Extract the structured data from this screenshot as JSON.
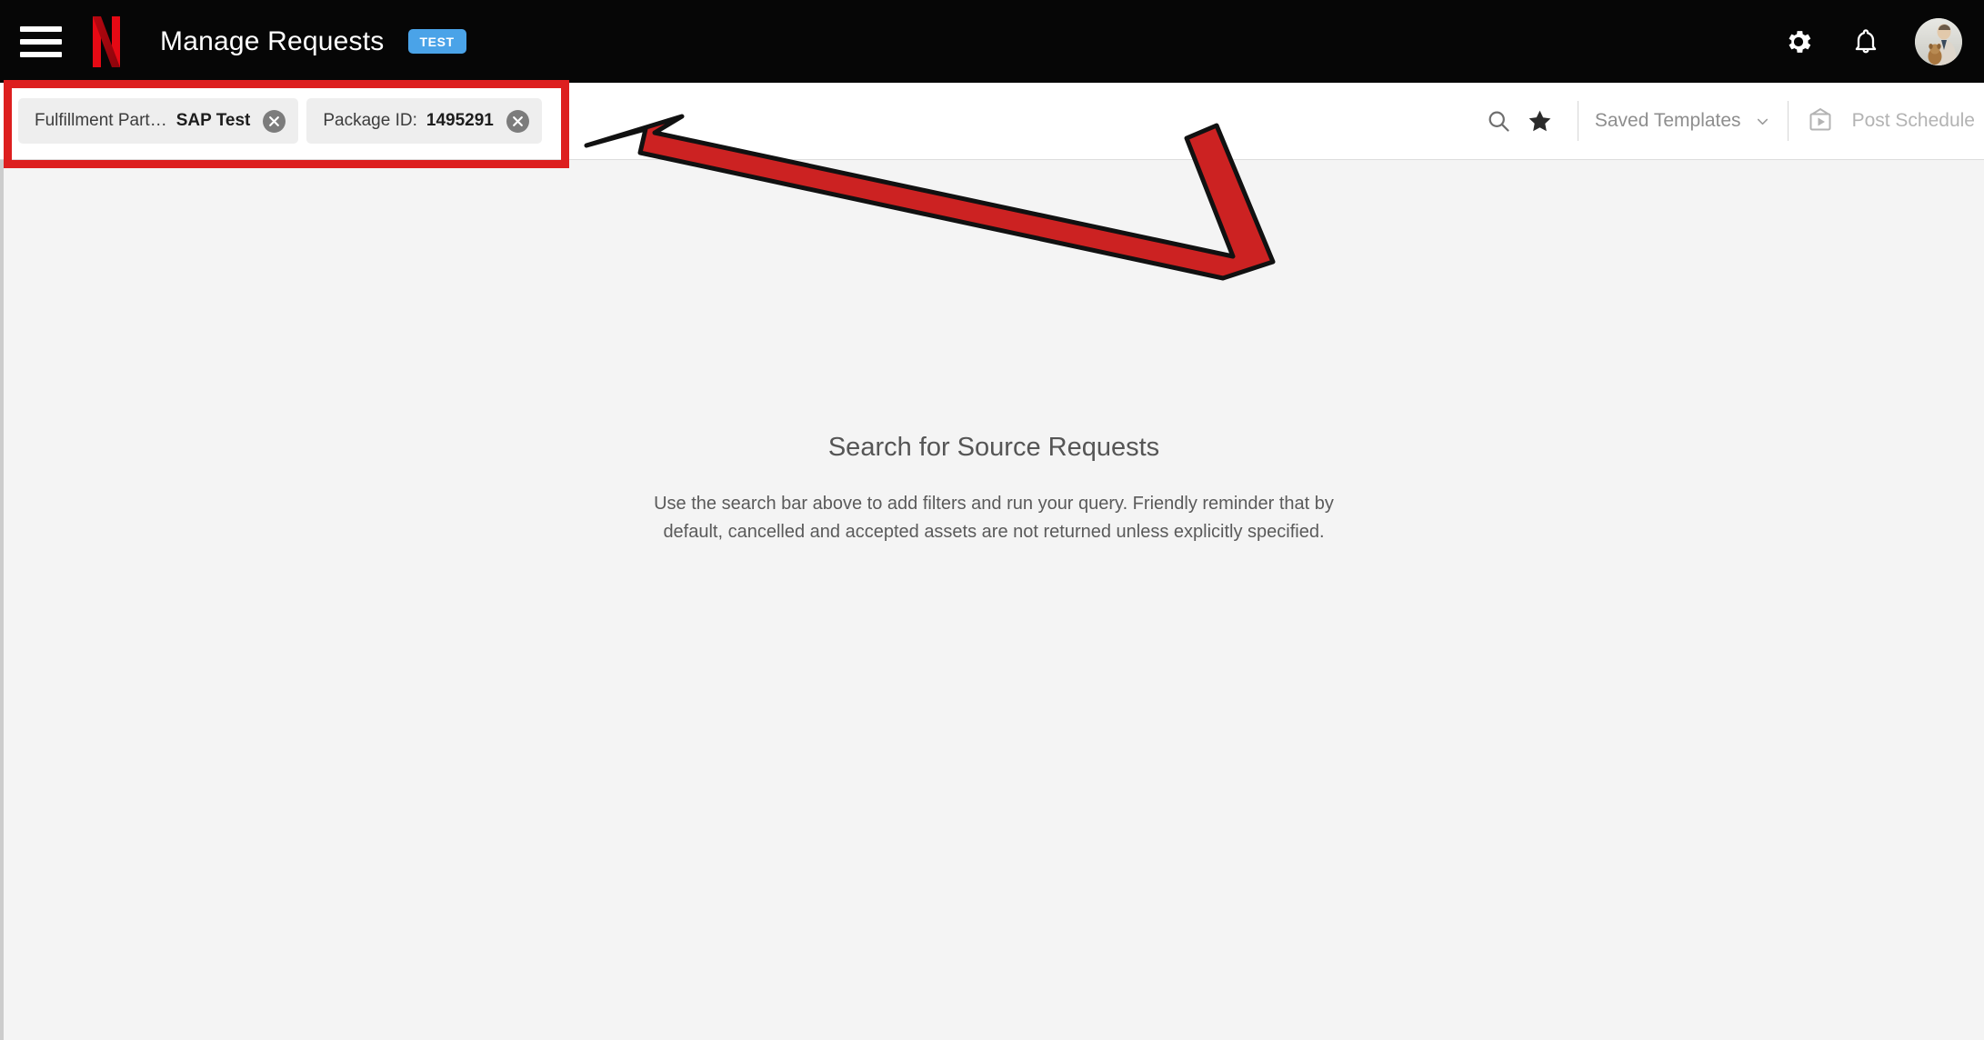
{
  "header": {
    "menu_icon": "hamburger-menu-icon",
    "brand_logo": "netflix-n-logo",
    "title": "Manage Requests",
    "env_badge": "TEST",
    "settings_icon": "gear-icon",
    "notifications_icon": "bell-icon",
    "avatar": "user-avatar"
  },
  "toolbar": {
    "filter_chips": [
      {
        "key": "Fulfillment Part…",
        "value": "SAP Test",
        "remove_icon": "close-circle-icon"
      },
      {
        "key": "Package ID:",
        "value": "1495291",
        "remove_icon": "close-circle-icon"
      }
    ],
    "search_icon": "search-icon",
    "favorite_icon": "star-filled-icon",
    "saved_templates_label": "Saved Templates",
    "saved_templates_chevron": "chevron-down-icon",
    "post_schedule_icon": "tv-play-icon",
    "post_schedule_label": "Post Schedule"
  },
  "main": {
    "empty_title": "Search for Source Requests",
    "empty_subtitle": "Use the search bar above to add filters and run your query. Friendly reminder that by default, cancelled and accepted assets are not returned unless explicitly specified."
  },
  "annotations": {
    "highlight_box": "filter-chips-region",
    "arrow": "double-headed-bent-arrow"
  },
  "colors": {
    "header_bg": "#060606",
    "brand_red": "#e50914",
    "env_badge_bg": "#4aa3e8",
    "content_bg": "#f4f4f4",
    "chip_bg": "#eeeeee",
    "annotation_red": "#dd1f1f"
  }
}
